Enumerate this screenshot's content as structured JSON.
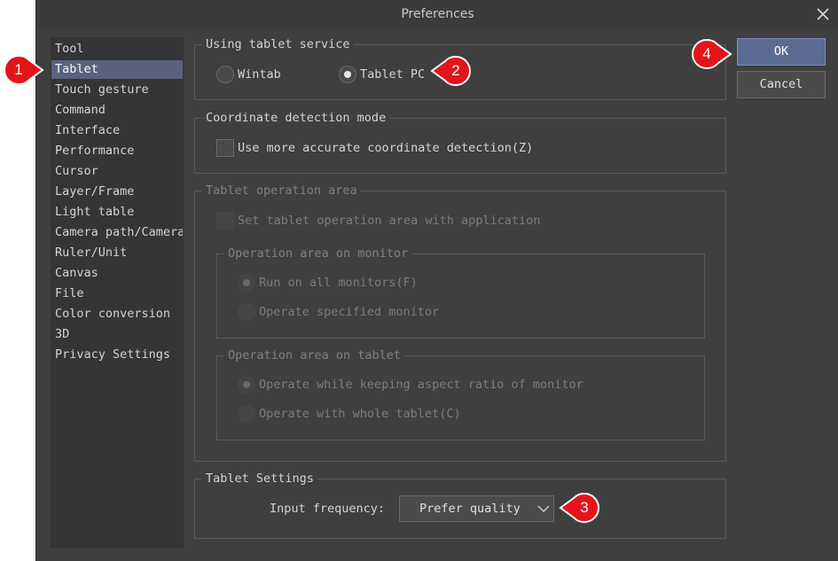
{
  "window": {
    "title": "Preferences"
  },
  "sidebar": {
    "items": [
      {
        "label": "Tool"
      },
      {
        "label": "Tablet"
      },
      {
        "label": "Touch gesture"
      },
      {
        "label": "Command"
      },
      {
        "label": "Interface"
      },
      {
        "label": "Performance"
      },
      {
        "label": "Cursor"
      },
      {
        "label": "Layer/Frame"
      },
      {
        "label": "Light table"
      },
      {
        "label": "Camera path/Camera"
      },
      {
        "label": "Ruler/Unit"
      },
      {
        "label": "Canvas"
      },
      {
        "label": "File"
      },
      {
        "label": "Color conversion"
      },
      {
        "label": "3D"
      },
      {
        "label": "Privacy Settings"
      }
    ],
    "selected": "Tablet"
  },
  "tablet_service": {
    "title": "Using tablet service",
    "options": [
      {
        "label": "Wintab",
        "checked": false
      },
      {
        "label": "Tablet PC",
        "checked": true
      }
    ]
  },
  "coordinate_detection": {
    "title": "Coordinate detection mode",
    "checkbox_label": "Use more accurate coordinate detection(Z)",
    "checked": false
  },
  "operation_area": {
    "title": "Tablet operation area",
    "checkbox_label": "Set tablet operation area with application",
    "monitor": {
      "title": "Operation area on monitor",
      "options": [
        {
          "label": "Run on all monitors(F)",
          "checked": true
        },
        {
          "label": "Operate specified monitor",
          "checked": false
        }
      ]
    },
    "tablet": {
      "title": "Operation area on tablet",
      "options": [
        {
          "label": "Operate while keeping aspect ratio of monitor",
          "checked": true
        },
        {
          "label": "Operate with whole tablet(C)",
          "checked": false
        }
      ]
    }
  },
  "tablet_settings": {
    "title": "Tablet Settings",
    "input_frequency_label": "Input frequency:",
    "input_frequency_value": "Prefer quality"
  },
  "buttons": {
    "ok": "OK",
    "cancel": "Cancel"
  },
  "annotations": {
    "m1": "1",
    "m2": "2",
    "m3": "3",
    "m4": "4",
    "color": "#e3151a"
  },
  "colors": {
    "background": "#3f3f3f",
    "selection": "#5a627e",
    "ok_button": "#5b6a93"
  }
}
